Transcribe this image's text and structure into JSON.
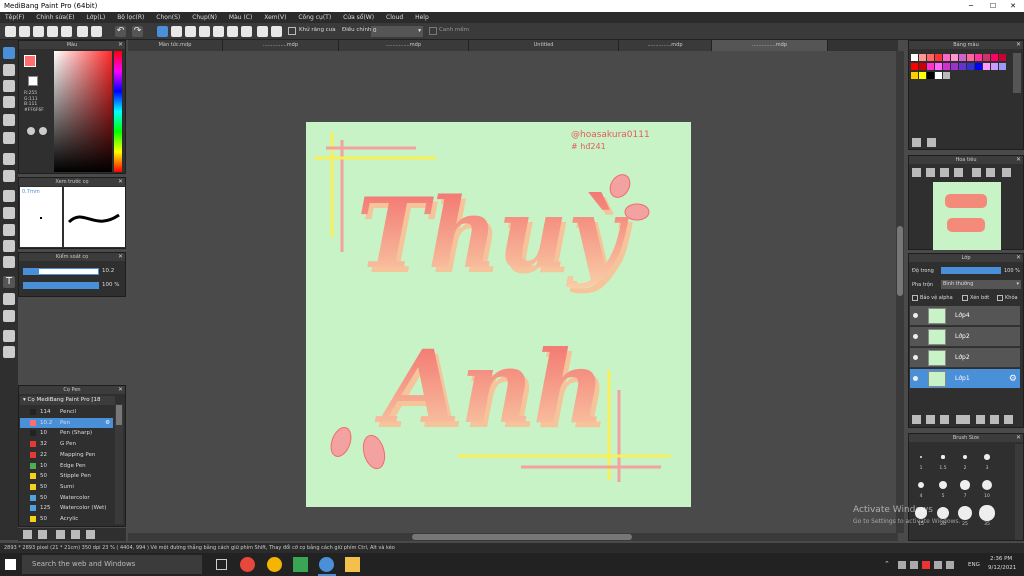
{
  "window": {
    "title": "MediBang Paint Pro (64bit)"
  },
  "menu": [
    "Tệp(F)",
    "Chỉnh sửa(E)",
    "Lớp(L)",
    "Bộ lọc(R)",
    "Chọn(S)",
    "Chụp(N)",
    "Màu (C)",
    "Xem(V)",
    "Công cụ(T)",
    "Cửa sổ(W)",
    "Cloud",
    "Help"
  ],
  "toolbar": {
    "antialias_label": "Khử răng cưa",
    "correction_label": "Điều chỉnh",
    "correction_value": "0",
    "snap_label": "Canh mềm"
  },
  "tabs": [
    "Màn tức.mdp",
    "...............mdp",
    "...............mdp",
    "Untitled",
    "...............mdp",
    "...............mdp"
  ],
  "color_panel": {
    "title": "Màu",
    "r": "R:255",
    "g": "G:111",
    "b": "B:111",
    "hex": "#FF6F6F"
  },
  "brush_preview": {
    "title": "Xem trước cọ",
    "size": "0.7mm"
  },
  "brush_control": {
    "title": "Kiểm soát cọ",
    "size_value": "10.2",
    "opacity_value": "100 %"
  },
  "brush_list": {
    "title": "Cọ Pen",
    "group": "Cọ MediBang Paint Pro [18",
    "items": [
      {
        "num": "114",
        "name": "Pencil",
        "color": "#222222"
      },
      {
        "num": "10.2",
        "name": "Pen",
        "color": "#ff6f6f"
      },
      {
        "num": "10",
        "name": "Pen (Sharp)",
        "color": "#222222"
      },
      {
        "num": "32",
        "name": "G Pen",
        "color": "#e53935"
      },
      {
        "num": "22",
        "name": "Mapping Pen",
        "color": "#e53935"
      },
      {
        "num": "10",
        "name": "Edge Pen",
        "color": "#4caf50"
      },
      {
        "num": "50",
        "name": "Stipple Pen",
        "color": "#f2d21c"
      },
      {
        "num": "50",
        "name": "Sumi",
        "color": "#f2d21c"
      },
      {
        "num": "50",
        "name": "Watercolor",
        "color": "#4fa3e0"
      },
      {
        "num": "125",
        "name": "Watercolor (Wet)",
        "color": "#4fa3e0"
      },
      {
        "num": "50",
        "name": "Acrylic",
        "color": "#f2d21c"
      }
    ]
  },
  "palette": {
    "title": "Bảng màu"
  },
  "navigator": {
    "title": "Hoa tiêu"
  },
  "layers": {
    "title": "Lớp",
    "opacity_label": "Độ trong",
    "opacity_value": "100 %",
    "blend_label": "Pha trộn",
    "blend_value": "Bình thường",
    "protect_alpha": "Bảo vệ alpha",
    "clipping": "Xén bớt",
    "lock": "Khóa",
    "items": [
      {
        "name": "Lớp4",
        "selected": false
      },
      {
        "name": "Lớp2",
        "selected": false
      },
      {
        "name": "Lớp2",
        "selected": false
      },
      {
        "name": "Lớp1",
        "selected": true
      }
    ]
  },
  "brush_size": {
    "title": "Brush Size",
    "labels": [
      "1",
      "1.5",
      "2",
      "3",
      "4",
      "5",
      "7",
      "10",
      "15",
      "20",
      "25",
      "35"
    ]
  },
  "artwork": {
    "handle_line1": "@hoasakura0111",
    "handle_line2": "# hđ241",
    "word1": "Thuỳ",
    "word2": "Anh"
  },
  "status": {
    "text": "2893 * 2893 pixel  (21 * 21cm)  350 dpi  23 %  ( 4404, 994 )  Vẽ một đường thẳng bằng cách giữ phím Shift, Thay đổi cỡ cọ bằng cách giữ phím Ctrl, Alt và kéo"
  },
  "watermark": {
    "line1": "Activate Windows",
    "line2": "Go to Settings to activate Windows."
  },
  "taskbar": {
    "search_placeholder": "Search the web and Windows",
    "time": "2:36 PM",
    "date": "9/12/2021",
    "lang": "ENG"
  },
  "colors": {
    "accent": "#4a90d9",
    "canvas_bg": "#c8f3c6",
    "pink": "#f26b6b",
    "peach": "#f5c49a",
    "yellow": "#f7f05a"
  }
}
